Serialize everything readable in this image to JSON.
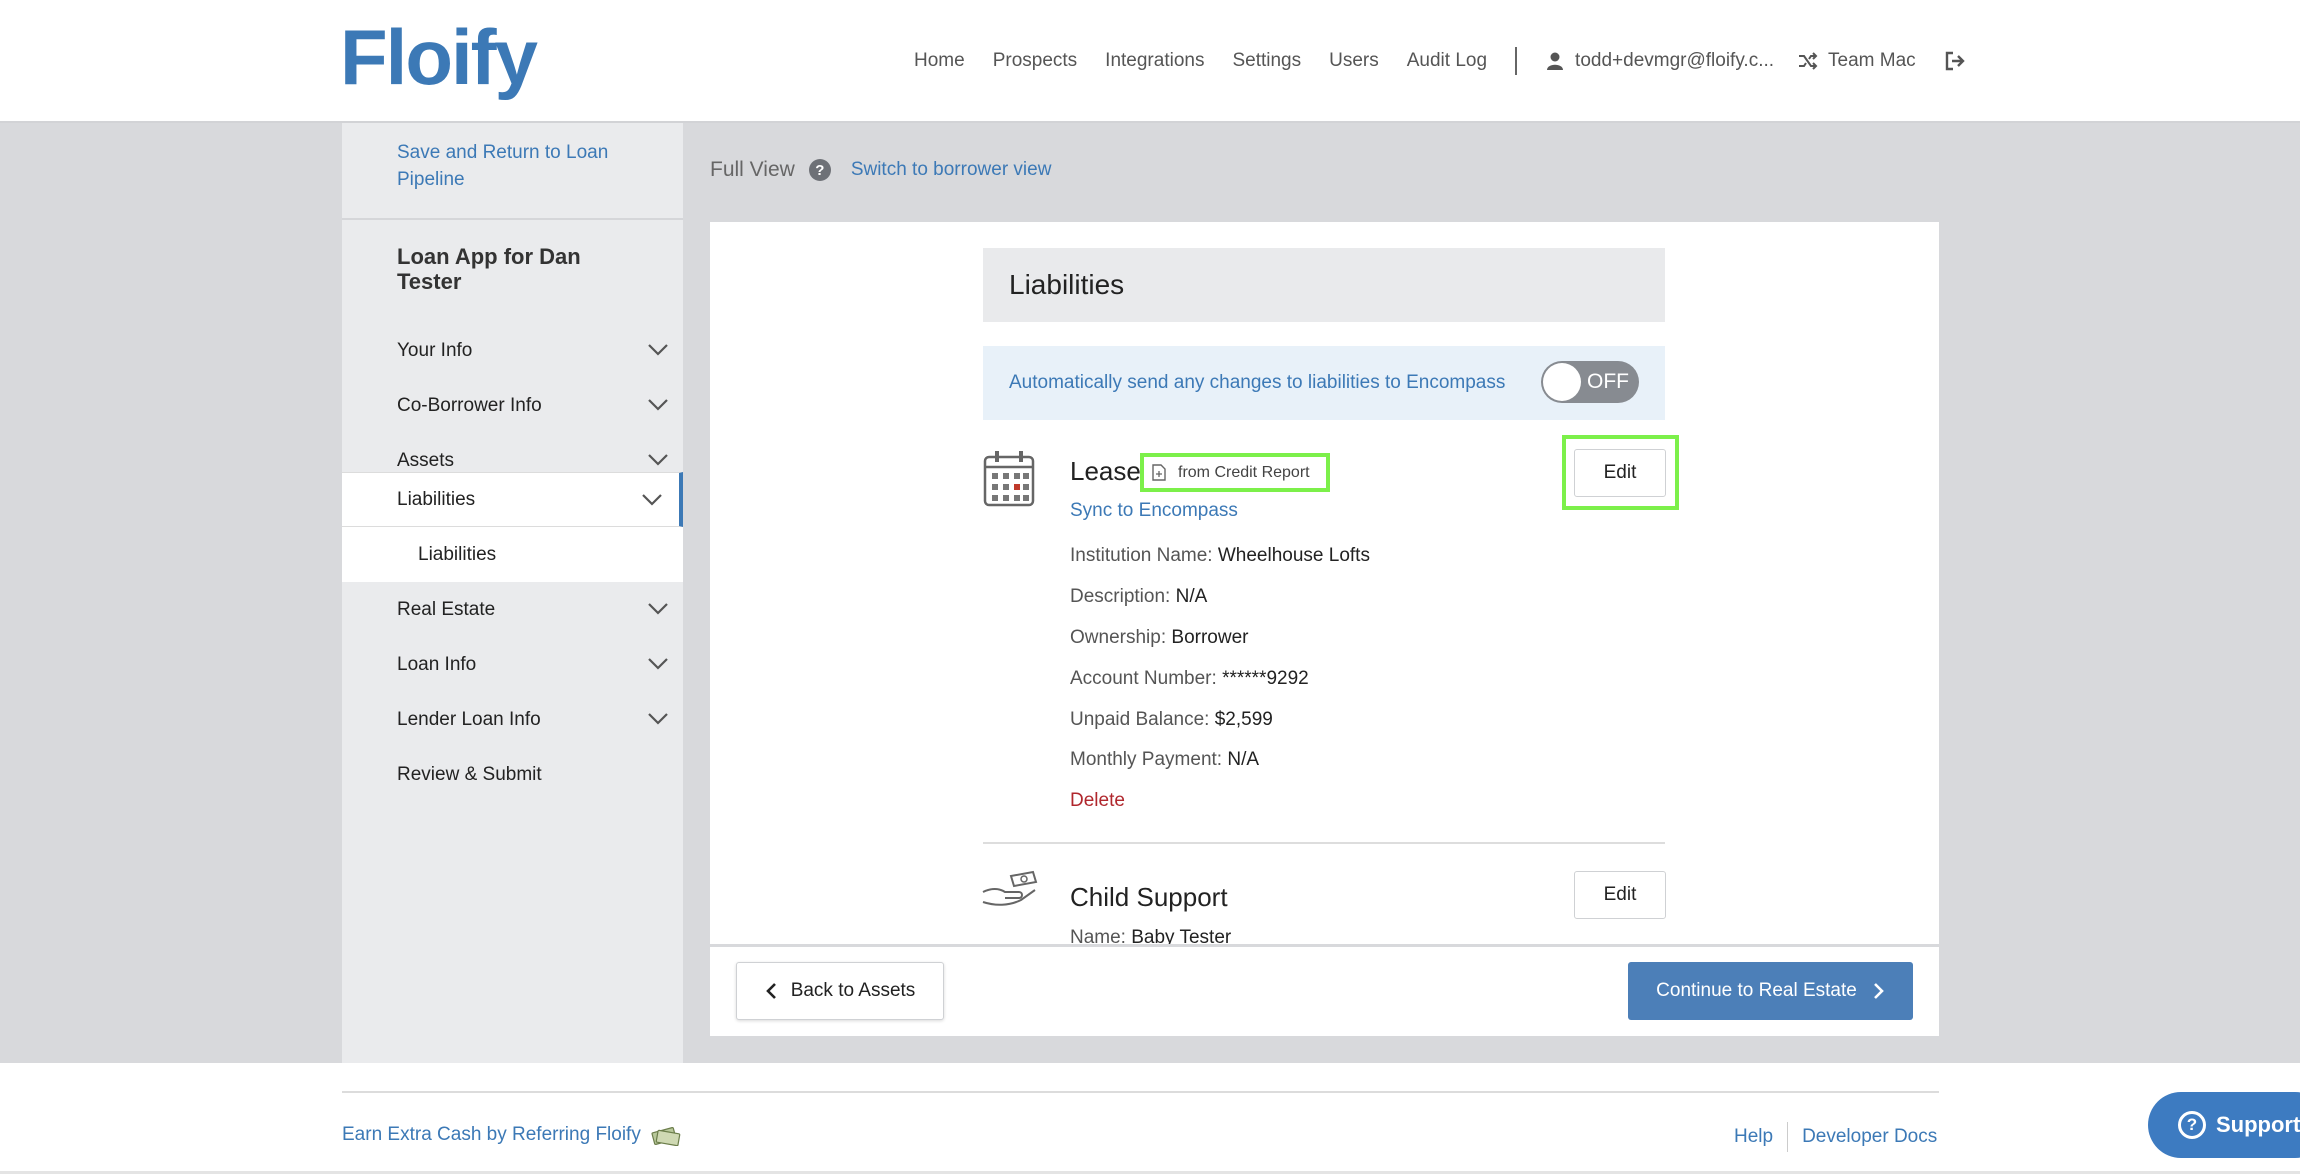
{
  "header": {
    "logo": "Floify",
    "nav": [
      "Home",
      "Prospects",
      "Integrations",
      "Settings",
      "Users",
      "Audit Log"
    ],
    "user_email": "todd+devmgr@floify.c...",
    "team": "Team Mac"
  },
  "sidebar": {
    "save_return": "Save and Return to Loan Pipeline",
    "title": "Loan App for Dan Tester",
    "items": [
      {
        "label": "Your Info"
      },
      {
        "label": "Co-Borrower Info"
      },
      {
        "label": "Assets"
      },
      {
        "label": "Liabilities"
      },
      {
        "label": "Real Estate"
      },
      {
        "label": "Loan Info"
      },
      {
        "label": "Lender Loan Info"
      },
      {
        "label": "Review & Submit"
      }
    ],
    "sub_items": [
      "Liabilities"
    ]
  },
  "main": {
    "view_label": "Full View",
    "help_glyph": "?",
    "switch_link": "Switch to borrower view",
    "section_title": "Liabilities",
    "autosend_text": "Automatically send any changes to liabilities to Encompass",
    "toggle_label": "OFF",
    "liabilities": [
      {
        "title": "Lease",
        "badge": "from Credit Report",
        "edit": "Edit",
        "sync": "Sync to Encompass",
        "fields": [
          {
            "label": "Institution Name:",
            "value": "Wheelhouse Lofts"
          },
          {
            "label": "Description:",
            "value": "N/A"
          },
          {
            "label": "Ownership:",
            "value": "Borrower"
          },
          {
            "label": "Account Number:",
            "value": "******9292"
          },
          {
            "label": "Unpaid Balance:",
            "value": "$2,599"
          },
          {
            "label": "Monthly Payment:",
            "value": "N/A"
          }
        ],
        "delete": "Delete"
      },
      {
        "title": "Child Support",
        "edit": "Edit",
        "fields": [
          {
            "label": "Name:",
            "value": "Baby Tester"
          }
        ]
      }
    ],
    "back_button": "Back to Assets",
    "continue_button": "Continue to Real Estate"
  },
  "footer": {
    "refer": "Earn Extra Cash by Referring Floify",
    "help": "Help",
    "dev_docs": "Developer Docs",
    "support": "Support"
  },
  "colors": {
    "brand_blue": "#3c79b6",
    "highlight_green": "#7cf04a",
    "delete_red": "#b0272d",
    "button_blue": "#4c7fb8"
  }
}
